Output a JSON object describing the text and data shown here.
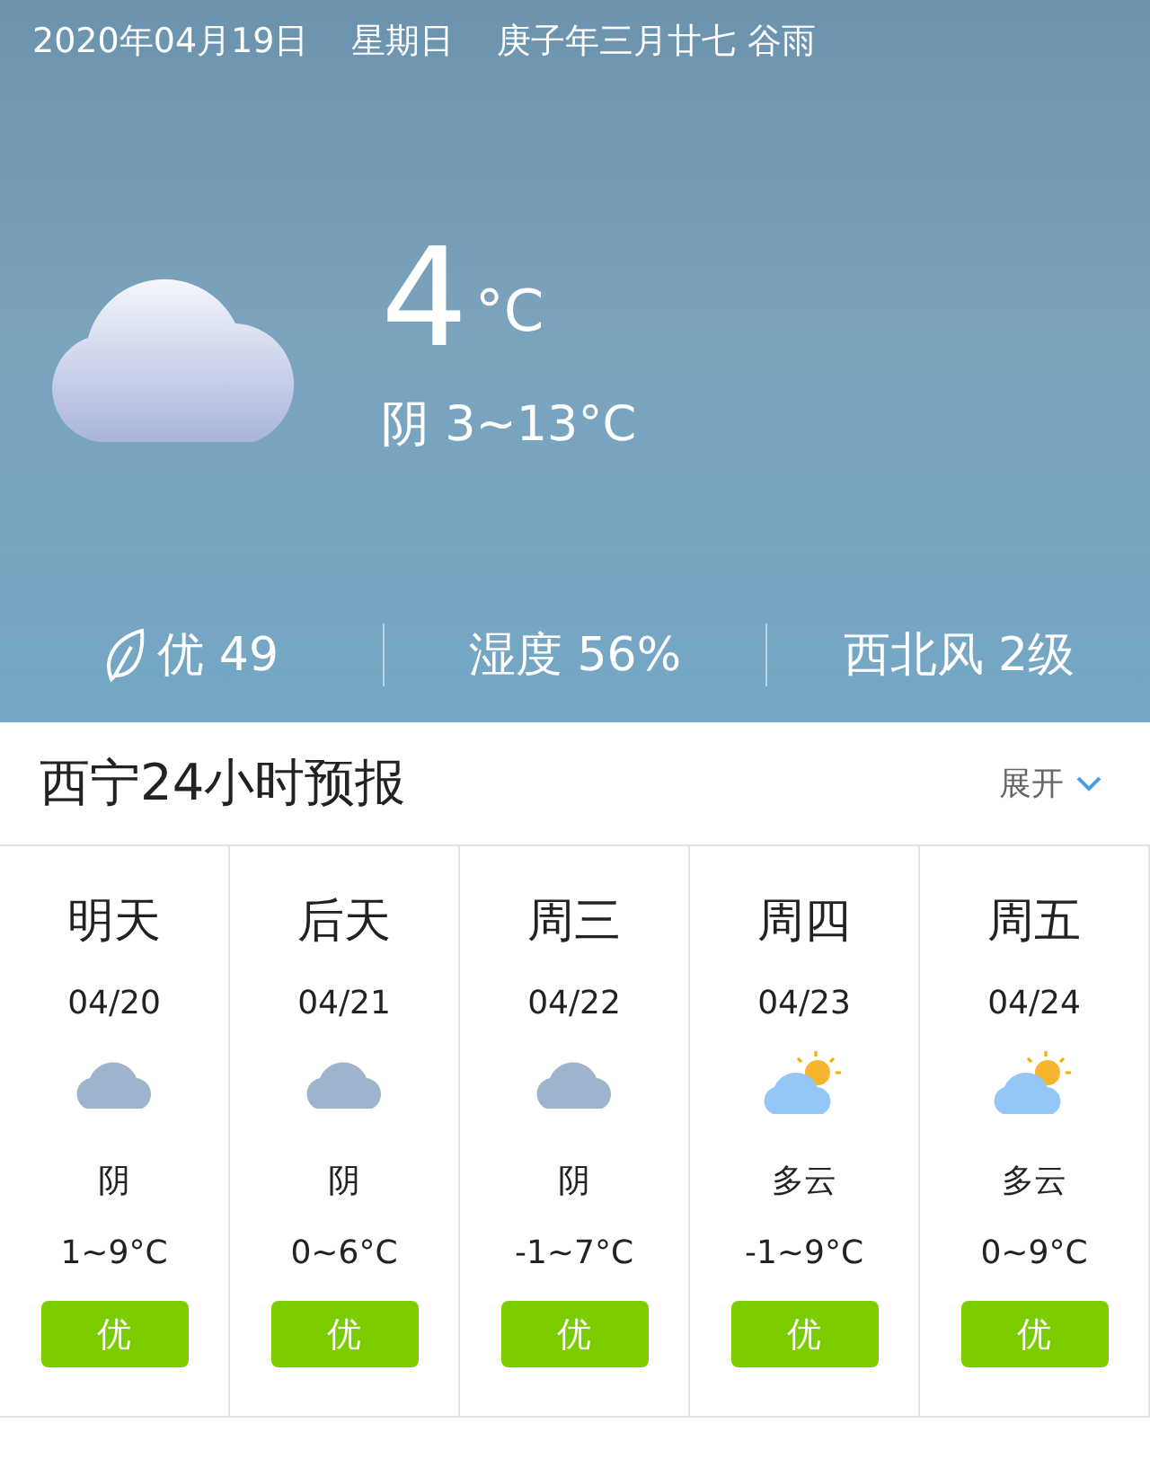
{
  "header": {
    "date": "2020年04月19日",
    "weekday": "星期日",
    "lunar": "庚子年三月廿七 谷雨"
  },
  "current": {
    "temperature": "4",
    "unit": "°C",
    "condition_range": "阴 3~13°C"
  },
  "stats": [
    {
      "kind": "air",
      "text": "优 49"
    },
    {
      "kind": "plain",
      "text": "湿度 56%"
    },
    {
      "kind": "plain",
      "text": "西北风 2级"
    }
  ],
  "forecast_section": {
    "title": "西宁24小时预报",
    "expand_label": "展开"
  },
  "days": [
    {
      "day": "明天",
      "date": "04/20",
      "kind": "overcast",
      "condition": "阴",
      "range": "1~9°C",
      "air": "优"
    },
    {
      "day": "后天",
      "date": "04/21",
      "kind": "overcast",
      "condition": "阴",
      "range": "0~6°C",
      "air": "优"
    },
    {
      "day": "周三",
      "date": "04/22",
      "kind": "overcast",
      "condition": "阴",
      "range": "-1~7°C",
      "air": "优"
    },
    {
      "day": "周四",
      "date": "04/23",
      "kind": "partly_cloudy",
      "condition": "多云",
      "range": "-1~9°C",
      "air": "优"
    },
    {
      "day": "周五",
      "date": "04/24",
      "kind": "partly_cloudy",
      "condition": "多云",
      "range": "0~9°C",
      "air": "优"
    }
  ]
}
